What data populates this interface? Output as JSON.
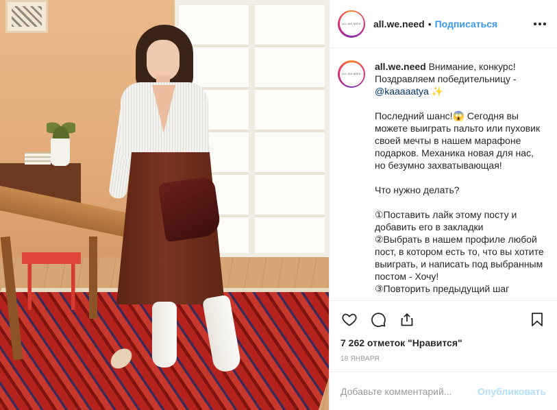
{
  "post": {
    "username": "all.we.need",
    "follow_label": "Подписаться",
    "separator": "•",
    "avatar_text": "ALL.WE.NEED",
    "more_icon": "more-horizontal-icon"
  },
  "caption": {
    "username": "all.we.need",
    "line1": "Внимание, конкурс!",
    "line2": "Поздравляем победительницу -",
    "mention": "@kaaaaatya",
    "sparkle": "✨",
    "para2_a": "Последний шанс!",
    "para2_emoji": "😱",
    "para2_b": "Сегодня вы можете выиграть пальто или пуховик своей мечты в нашем марафоне подарков. Механика новая для нас, но безумно захватывающая!",
    "para3": "Что нужно делать?",
    "step1": "①Поставить лайк этому посту и добавить его в закладки",
    "step2": "②Выбрать в нашем профиле любой пост, в котором есть то, что вы хотите выиграть, и написать под выбранным постом - Хочу!",
    "step3": "③Повторить предыдущий шаг"
  },
  "actions": {
    "icons": [
      "heart-icon",
      "comment-icon",
      "share-icon",
      "bookmark-icon"
    ]
  },
  "likes_text": "7 262 отметок \"Нравится\"",
  "date_text": "18 января",
  "comment": {
    "placeholder": "Добавьте комментарий...",
    "publish_label": "Опубликовать"
  },
  "colors": {
    "accent": "#3897f0",
    "publish_disabled": "#b2dffc",
    "mention": "#003569",
    "muted": "#999999"
  }
}
